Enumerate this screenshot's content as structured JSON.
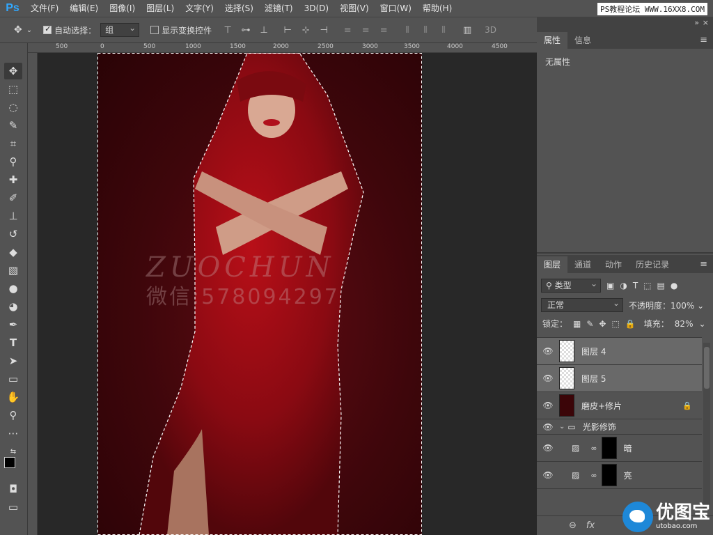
{
  "app": {
    "logo": "Ps"
  },
  "menu": [
    "文件(F)",
    "编辑(E)",
    "图像(I)",
    "图层(L)",
    "文字(Y)",
    "选择(S)",
    "滤镜(T)",
    "3D(D)",
    "视图(V)",
    "窗口(W)",
    "帮助(H)"
  ],
  "site_watermark": "PS教程论坛 WWW.16XX8.COM",
  "options": {
    "auto_select_label": "自动选择：",
    "auto_select_checked": true,
    "auto_select_value": "组",
    "show_transform_label": "显示变换控件",
    "show_transform_checked": false,
    "mode_3d": "3D"
  },
  "ruler": {
    "ticks": [
      "500",
      "0",
      "500",
      "1000",
      "1500",
      "2000",
      "2500",
      "3000",
      "3500",
      "4000",
      "4500"
    ]
  },
  "canvas_watermark": {
    "en": "ZUOCHUN",
    "cn": "微信:578094297"
  },
  "properties_panel": {
    "tabs": [
      "属性",
      "信息"
    ],
    "active_tab": "属性",
    "body_text": "无属性"
  },
  "layers_panel": {
    "tabs": [
      "图层",
      "通道",
      "动作",
      "历史记录"
    ],
    "active_tab": "图层",
    "kind_filter": "类型",
    "blend_mode": "正常",
    "opacity_label": "不透明度：",
    "opacity_value": "100%",
    "lock_label": "锁定：",
    "fill_label": "填充：",
    "fill_value": "82%",
    "layers": [
      {
        "name": "图层 4",
        "selected": true
      },
      {
        "name": "图层 5",
        "selected": true
      },
      {
        "name": "磨皮+修片",
        "locked": true
      },
      {
        "name": "光影修饰",
        "group": true
      },
      {
        "name": "暗",
        "adjustment": true
      },
      {
        "name": "亮",
        "adjustment": true
      }
    ],
    "footer_icons": [
      "link-icon",
      "fx-icon"
    ]
  },
  "brand": {
    "cn": "优图宝",
    "url": "utobao.com"
  }
}
